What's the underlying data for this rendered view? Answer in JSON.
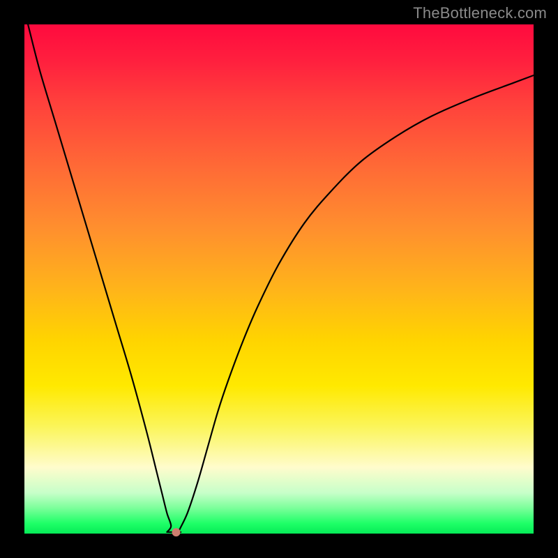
{
  "watermark": "TheBottleneck.com",
  "colors": {
    "background": "#000000",
    "gradient_stops": [
      {
        "pos": 0.0,
        "color": "#ff0a3e"
      },
      {
        "pos": 0.07,
        "color": "#ff1f3e"
      },
      {
        "pos": 0.15,
        "color": "#ff3f3c"
      },
      {
        "pos": 0.28,
        "color": "#ff6a36"
      },
      {
        "pos": 0.4,
        "color": "#ff8f2e"
      },
      {
        "pos": 0.52,
        "color": "#ffb41a"
      },
      {
        "pos": 0.62,
        "color": "#ffd400"
      },
      {
        "pos": 0.71,
        "color": "#ffe900"
      },
      {
        "pos": 0.79,
        "color": "#fbf55a"
      },
      {
        "pos": 0.87,
        "color": "#fffccc"
      },
      {
        "pos": 0.92,
        "color": "#c7ffc9"
      },
      {
        "pos": 0.95,
        "color": "#7bff9a"
      },
      {
        "pos": 0.98,
        "color": "#1eff67"
      },
      {
        "pos": 1.0,
        "color": "#06ec57"
      }
    ],
    "curve": "#000000",
    "marker": "#cd7e6f"
  },
  "chart_data": {
    "type": "line",
    "title": "",
    "xlabel": "",
    "ylabel": "",
    "xlim": [
      0,
      100
    ],
    "ylim": [
      0,
      100
    ],
    "grid": false,
    "series": [
      {
        "name": "bottleneck-curve",
        "x": [
          0.7,
          3,
          6,
          9,
          12,
          15,
          18,
          21,
          24,
          26,
          27,
          28,
          28.8,
          29.6,
          30.3,
          32,
          34,
          36,
          38,
          40,
          43,
          46,
          50,
          55,
          60,
          66,
          73,
          80,
          88,
          96,
          100
        ],
        "values": [
          100,
          91,
          81,
          71,
          61,
          51,
          41,
          31,
          20,
          12,
          8,
          4,
          1.5,
          0.4,
          0.4,
          4,
          10,
          17,
          24,
          30,
          38,
          45,
          53,
          61,
          67,
          73,
          78,
          82,
          85.5,
          88.5,
          90
        ]
      }
    ],
    "marker": {
      "x": 29.8,
      "y": 0.25
    },
    "flat_bottom": {
      "x_start": 28.0,
      "x_end": 30.7,
      "y": 0.3
    }
  }
}
